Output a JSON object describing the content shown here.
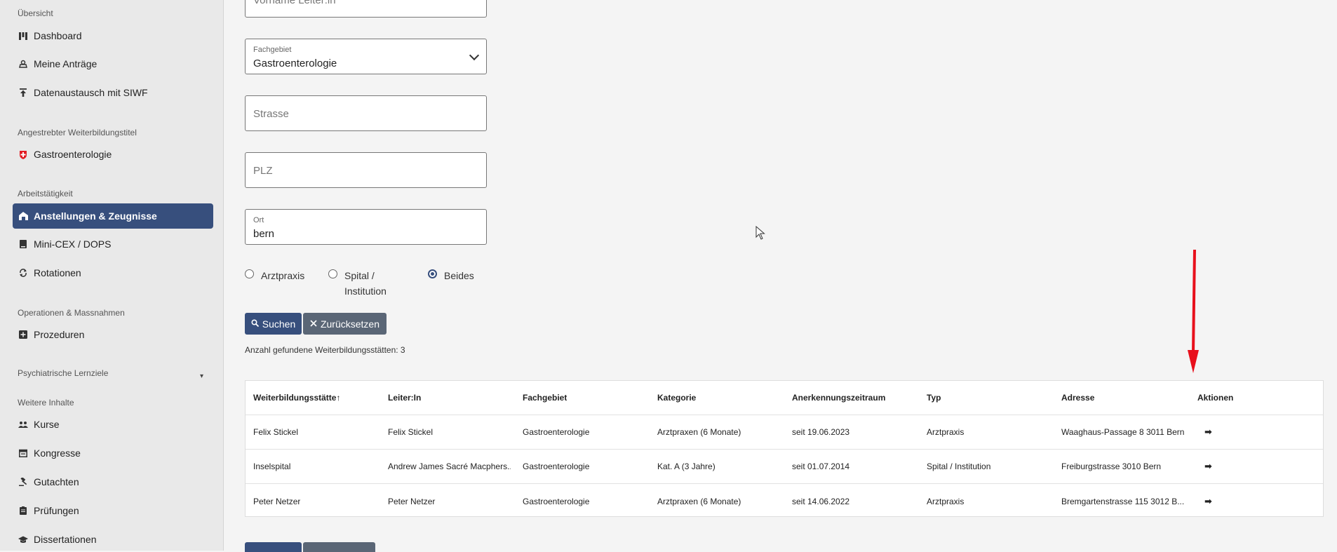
{
  "sidebar": {
    "sections": [
      {
        "title": "Übersicht"
      },
      {
        "title": "Angestrebter Weiterbildungstitel"
      },
      {
        "title": "Arbeitstätigkeit"
      },
      {
        "title": "Operationen & Massnahmen"
      },
      {
        "title": "Psychiatrische Lernziele"
      },
      {
        "title": "Weitere Inhalte"
      }
    ],
    "items": [
      {
        "label": "Dashboard",
        "icon": "dashboard-icon"
      },
      {
        "label": "Meine Anträge",
        "icon": "request-icon"
      },
      {
        "label": "Datenaustausch mit SIWF",
        "icon": "upload-icon"
      },
      {
        "label": "Gastroenterologie",
        "icon": "swiss-shield-icon"
      },
      {
        "label": "Anstellungen & Zeugnisse",
        "icon": "building-icon",
        "active": true
      },
      {
        "label": "Mini-CEX / DOPS",
        "icon": "book-icon"
      },
      {
        "label": "Rotationen",
        "icon": "rotate-icon"
      },
      {
        "label": "Prozeduren",
        "icon": "plus-square-icon"
      },
      {
        "label": "Kurse",
        "icon": "users-icon"
      },
      {
        "label": "Kongresse",
        "icon": "calendar-icon"
      },
      {
        "label": "Gutachten",
        "icon": "gavel-icon"
      },
      {
        "label": "Prüfungen",
        "icon": "clipboard-icon"
      },
      {
        "label": "Dissertationen",
        "icon": "graduation-cap-icon"
      }
    ]
  },
  "form": {
    "vorname_placeholder": "Vorname Leiter:in",
    "fachgebiet_label": "Fachgebiet",
    "fachgebiet_value": "Gastroenterologie",
    "strasse_placeholder": "Strasse",
    "plz_placeholder": "PLZ",
    "ort_label": "Ort",
    "ort_value": "bern",
    "radios": [
      {
        "label": "Arztpraxis",
        "checked": false
      },
      {
        "label": "Spital / Institution",
        "checked": false
      },
      {
        "label": "Beides",
        "checked": true
      }
    ],
    "search_label": "Suchen",
    "reset_label": "Zurücksetzen"
  },
  "results": {
    "count_text": "Anzahl gefundene Weiterbildungsstätten: 3",
    "columns": [
      "Weiterbildungsstätte",
      "Leiter:In",
      "Fachgebiet",
      "Kategorie",
      "Anerkennungszeitraum",
      "Typ",
      "Adresse",
      "Aktionen"
    ],
    "sort_indicator": "↑",
    "rows": [
      [
        "Felix Stickel",
        "Felix Stickel",
        "Gastroenterologie",
        "Arztpraxen (6 Monate)",
        "seit 19.06.2023",
        "Arztpraxis",
        "Waaghaus-Passage 8 3011 Bern",
        "➡"
      ],
      [
        "Inselspital",
        "Andrew James Sacré Macphers...",
        "Gastroenterologie",
        "Kat. A (3 Jahre)",
        "seit 01.07.2014",
        "Spital / Institution",
        "Freiburgstrasse 3010 Bern",
        "➡"
      ],
      [
        "Peter Netzer",
        "Peter Netzer",
        "Gastroenterologie",
        "Arztpraxen (6 Monate)",
        "seit 14.06.2022",
        "Arztpraxis",
        "Bremgartenstrasse 115 3012 B...",
        "➡"
      ]
    ]
  },
  "colors": {
    "primary": "#374f7d",
    "secondary": "#5a6676",
    "annotation_arrow": "#e8101c"
  }
}
